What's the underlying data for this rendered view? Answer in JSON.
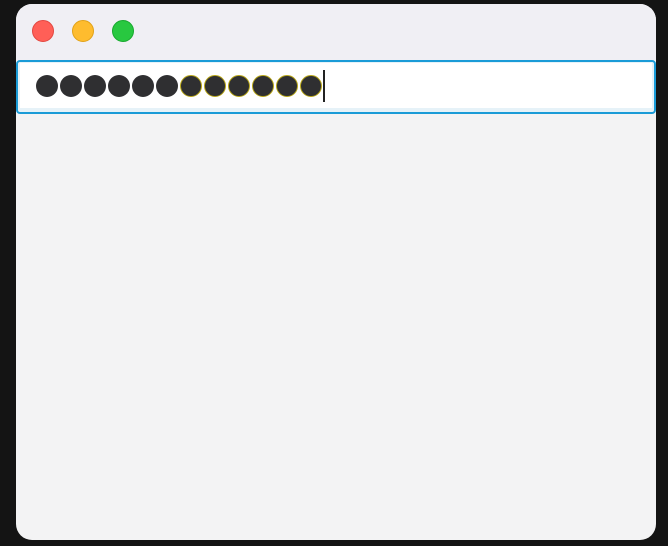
{
  "window": {
    "traffic_lights": [
      {
        "name": "close",
        "color": "#ff5f57"
      },
      {
        "name": "minimize",
        "color": "#febc2e"
      },
      {
        "name": "zoom",
        "color": "#28c840"
      }
    ]
  },
  "password_field": {
    "mask_char": "●",
    "masked_length": 12,
    "focus_ring_color": "#1a9bd7"
  }
}
